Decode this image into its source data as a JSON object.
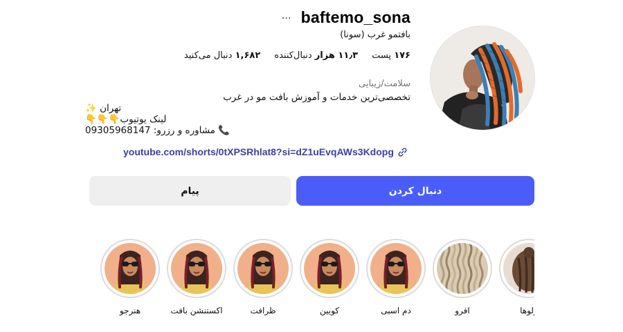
{
  "profile": {
    "username": "baftemo_sona",
    "more_icon": "…",
    "full_name": "بافتمو غرب (سونا)",
    "stats": {
      "posts_value": "۱۷۶",
      "posts_label": "پست",
      "followers_value": "۱۱٫۳ هزار",
      "followers_label": "دنبال‌کننده",
      "following_value": "۱,۶۸۲",
      "following_label": "دنبال می‌کنید"
    },
    "category": "سلامت/زیبایی",
    "bio": {
      "line1": "تخصصی‌ترین خدمات و آموزش بافت مو در غرب",
      "line2": "تهران ✨",
      "line3": "لینک یوتیوب👇👇👇",
      "line4": "📞 مشاوره و رزرو: 09305968147"
    },
    "link_text": "youtube.com/shorts/0tXPSRhlat8?si=dZ1uEvqAWs3Kdopg"
  },
  "buttons": {
    "follow_label": "دنبال کردن",
    "message_label": "پیام"
  },
  "highlights": [
    {
      "label": "ولوها",
      "image": "braids-back-photo"
    },
    {
      "label": "افرو",
      "image": "crimped-hair-photo"
    },
    {
      "label": "دم اسبی",
      "image": "girl-sunglasses-braids"
    },
    {
      "label": "کویین",
      "image": "girl-sunglasses-braids"
    },
    {
      "label": "ظرافت",
      "image": "girl-sunglasses-braids"
    },
    {
      "label": "اکستنشن بافت",
      "image": "girl-sunglasses-braids"
    },
    {
      "label": "هنرجو",
      "image": "girl-sunglasses-braids"
    }
  ],
  "colors": {
    "follow_button": "#4a5df9",
    "message_button": "#efefef",
    "link": "#3a3fa5",
    "category_text": "#737373",
    "highlight_ring": "#dbdbdb",
    "braid_orange": "#e36a2a",
    "braid_blue": "#3c7fb5"
  }
}
